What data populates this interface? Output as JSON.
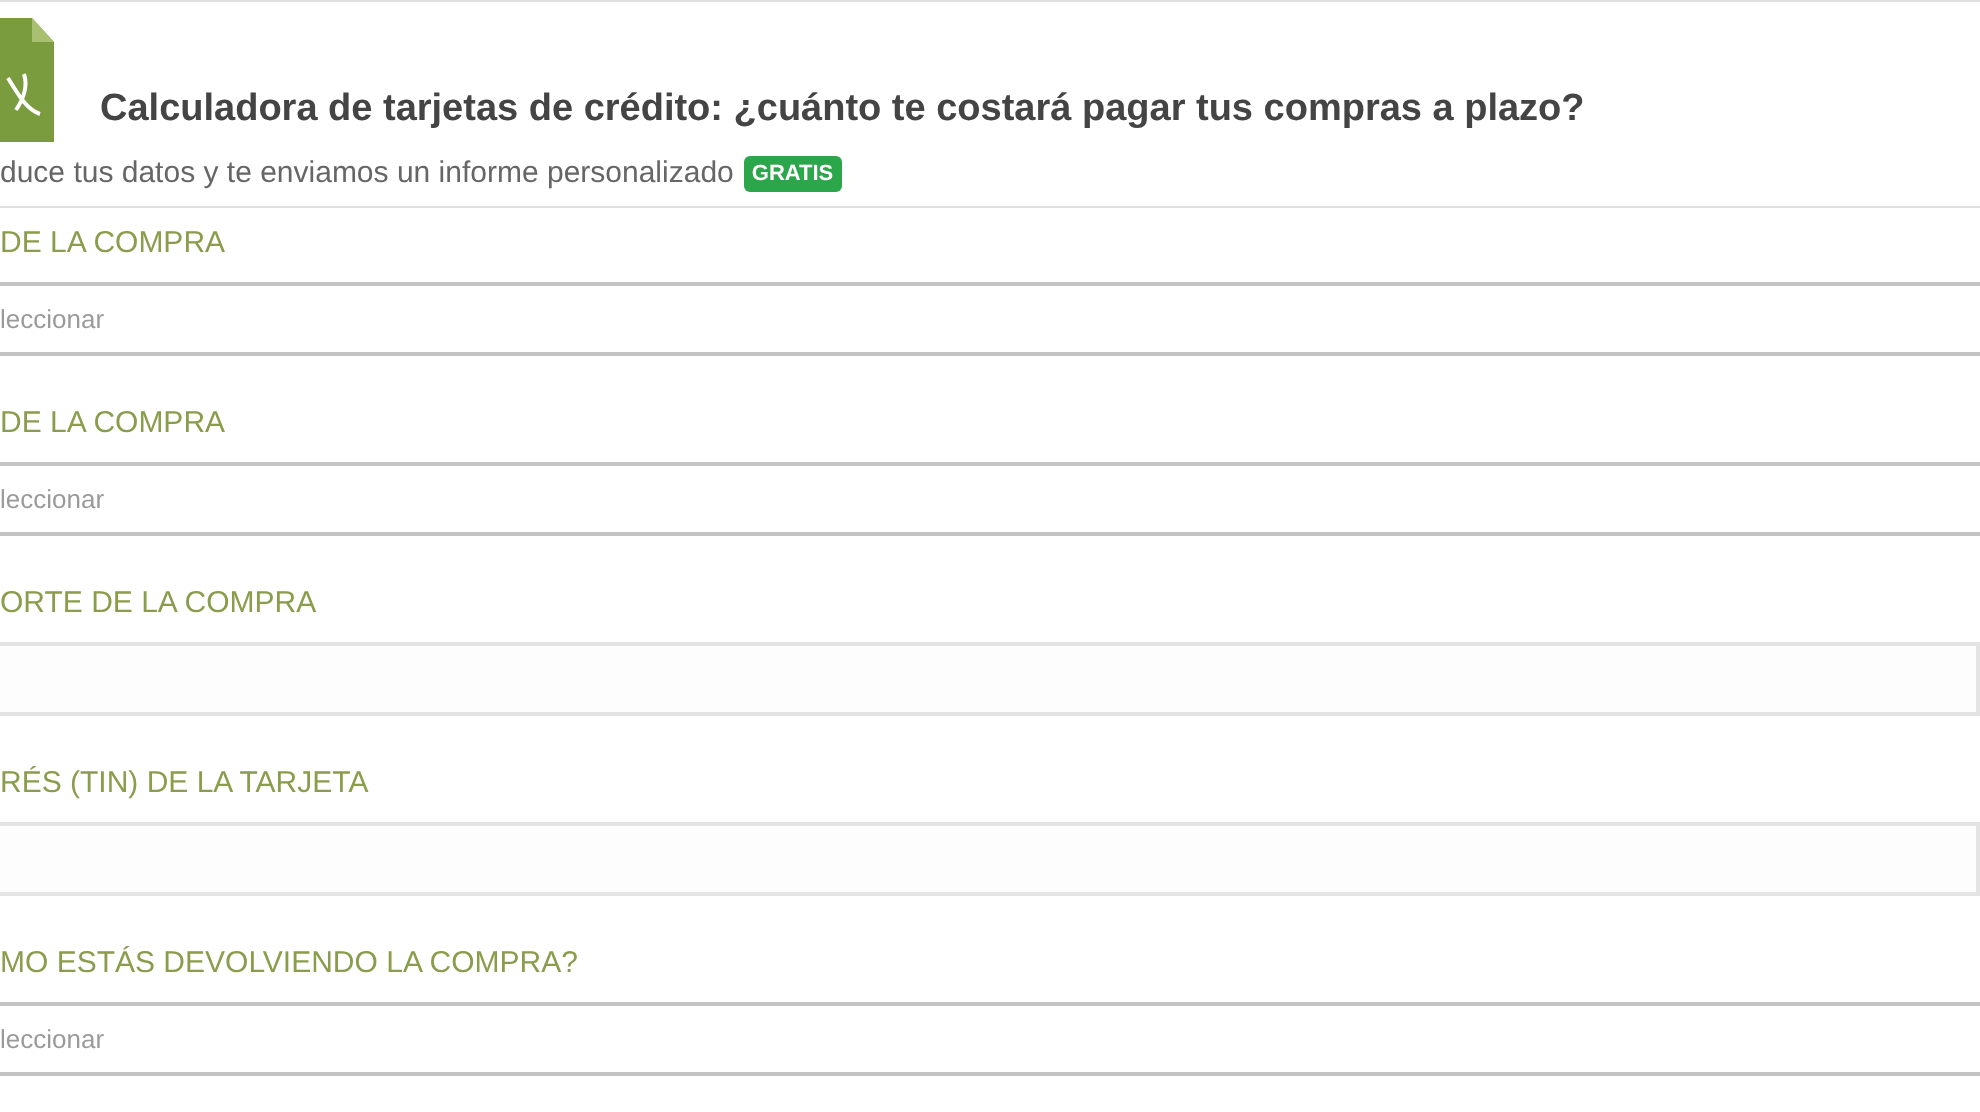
{
  "header": {
    "title": "Calculadora de tarjetas de crédito: ¿cuánto te costará pagar tus compras a plazo?",
    "subtitle": "duce tus datos y te enviamos un informe personalizado",
    "badge": "GRATIS"
  },
  "fields": [
    {
      "label": "DE LA COMPRA",
      "kind": "select",
      "placeholder": "leccionar"
    },
    {
      "label": "DE LA COMPRA",
      "kind": "select",
      "placeholder": "leccionar"
    },
    {
      "label": "ORTE DE LA COMPRA",
      "kind": "text"
    },
    {
      "label": "RÉS (TIN) DE LA TARJETA",
      "kind": "text"
    },
    {
      "label": "MO ESTÁS DEVOLVIENDO LA COMPRA?",
      "kind": "select",
      "placeholder": "leccionar"
    }
  ]
}
